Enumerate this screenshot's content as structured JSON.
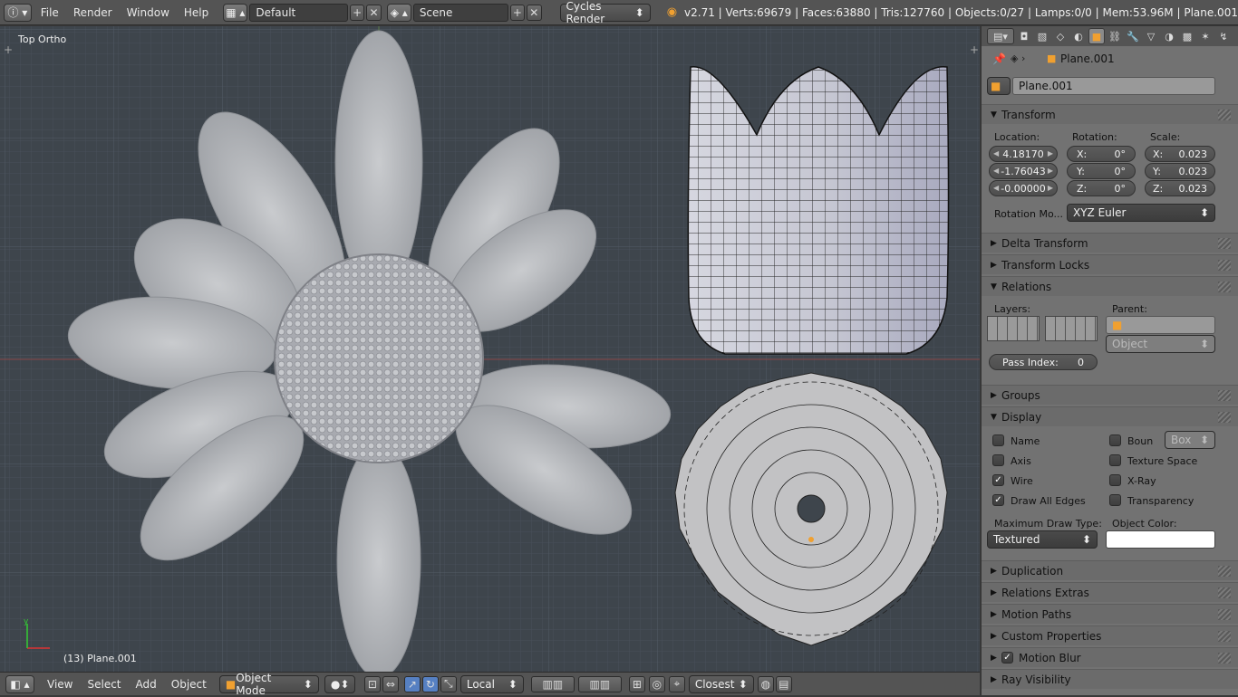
{
  "topbar": {
    "menus": [
      "File",
      "Render",
      "Window",
      "Help"
    ],
    "screen_layout": "Default",
    "scene": "Scene",
    "render_engine": "Cycles Render",
    "stats": "v2.71 | Verts:69679 | Faces:63880 | Tris:127760 | Objects:0/27 | Lamps:0/0 | Mem:53.96M | Plane.001"
  },
  "viewport": {
    "view_label": "Top Ortho",
    "object_label": "(13) Plane.001",
    "bg_color": "#3e454c"
  },
  "bottombar": {
    "menus": [
      "View",
      "Select",
      "Add",
      "Object"
    ],
    "mode": "Object Mode",
    "orientation": "Local",
    "snap_target": "Closest"
  },
  "properties": {
    "context_object": "Plane.001",
    "object_name": "Plane.001",
    "transform": {
      "title": "Transform",
      "location_label": "Location:",
      "rotation_label": "Rotation:",
      "scale_label": "Scale:",
      "location": [
        "4.18170",
        "-1.76043",
        "-0.00000"
      ],
      "rotation": [
        "X:",
        "Y:",
        "Z:"
      ],
      "rotation_values": [
        "0°",
        "0°",
        "0°"
      ],
      "scale_axes": [
        "X:",
        "Y:",
        "Z:"
      ],
      "scale_values": [
        "0.023",
        "0.023",
        "0.023"
      ],
      "rotation_mode_label": "Rotation Mo...",
      "rotation_mode": "XYZ Euler"
    },
    "panels_collapsed_1": [
      "Delta Transform",
      "Transform Locks"
    ],
    "relations": {
      "title": "Relations",
      "layers_label": "Layers:",
      "parent_label": "Parent:",
      "parent_type": "Object",
      "pass_index_label": "Pass Index:",
      "pass_index": "0"
    },
    "groups_title": "Groups",
    "display": {
      "title": "Display",
      "name": "Name",
      "axis": "Axis",
      "wire": "Wire",
      "draw_all_edges": "Draw All Edges",
      "bounds": "Boun",
      "bounds_type": "Box",
      "texture_space": "Texture Space",
      "xray": "X-Ray",
      "transparency": "Transparency",
      "max_draw_label": "Maximum Draw Type:",
      "max_draw": "Textured",
      "object_color_label": "Object Color:"
    },
    "panels_collapsed_2": [
      "Duplication",
      "Relations Extras",
      "Motion Paths",
      "Custom Properties"
    ],
    "motion_blur": "Motion Blur",
    "ray_visibility": "Ray Visibility"
  }
}
